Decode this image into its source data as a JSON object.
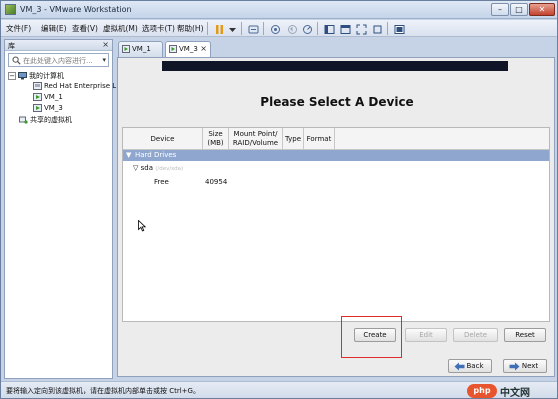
{
  "window": {
    "title": "VM_3 - VMware Workstation"
  },
  "menu": [
    "文件(F)",
    "编辑(E)",
    "查看(V)",
    "虚拟机(M)",
    "选项卡(T)",
    "帮助(H)"
  ],
  "library": {
    "title": "库",
    "close": "×",
    "search_placeholder": "在此处键入内容进行...",
    "tree": {
      "root": "我的计算机",
      "vms": [
        "Red Hat Enterprise L",
        "VM_1",
        "VM_3"
      ],
      "shared": "共享的虚拟机"
    }
  },
  "tabs": [
    {
      "label": "VM_1",
      "active": false
    },
    {
      "label": "VM_3",
      "active": true
    }
  ],
  "installer": {
    "heading": "Please Select A Device",
    "columns": [
      "Device",
      "Size (MB)",
      "Mount Point/ RAID/Volume",
      "Type",
      "Format"
    ],
    "group": "Hard Drives",
    "disk": {
      "name": "sda",
      "path": "(/dev/sda)"
    },
    "rows": [
      {
        "device": "Free",
        "size": "40954"
      }
    ],
    "buttons": {
      "create": "Create",
      "edit": "Edit",
      "delete": "Delete",
      "reset": "Reset",
      "back": "Back",
      "next": "Next"
    }
  },
  "status": "要将输入定向到该虚拟机，请在虚拟机内部单击或按 Ctrl+G。",
  "watermark": {
    "brand": "php",
    "site": "中文网"
  },
  "colors": {
    "highlight": "#e02b2b",
    "group_header": "#8fa7cf",
    "banner": "#0f1427"
  }
}
